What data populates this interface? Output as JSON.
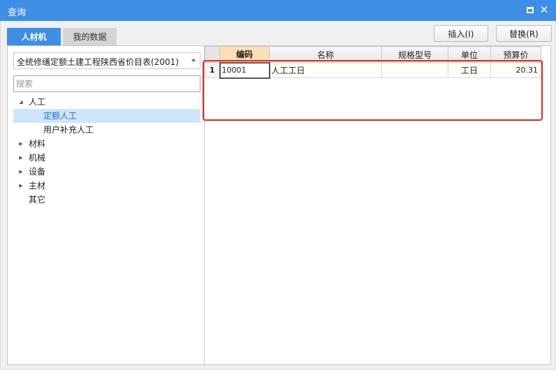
{
  "window": {
    "title": "查询",
    "maximize_icon": "maximize-icon",
    "close_icon": "close-icon"
  },
  "tabs": [
    {
      "label": "人材机",
      "active": true
    },
    {
      "label": "我的数据",
      "active": false
    }
  ],
  "toolbar": {
    "insert_label": "插入(I)",
    "replace_label": "替换(R)"
  },
  "left": {
    "combo_value": "全统修缮定额土建工程陕西省价目表(2001)",
    "search_placeholder": "搜索",
    "tree": [
      {
        "label": "人工",
        "level": 0,
        "expanded": true
      },
      {
        "label": "定额人工",
        "level": 1,
        "selected": true
      },
      {
        "label": "用户补充人工",
        "level": 1
      },
      {
        "label": "材料",
        "level": 0,
        "expanded": false
      },
      {
        "label": "机械",
        "level": 0,
        "expanded": false
      },
      {
        "label": "设备",
        "level": 0,
        "expanded": false
      },
      {
        "label": "主材",
        "level": 0,
        "expanded": false
      },
      {
        "label": "其它",
        "level": 0,
        "leaf": true
      }
    ]
  },
  "grid": {
    "headers": {
      "code": "编码",
      "name": "名称",
      "spec": "规格型号",
      "unit": "单位",
      "price": "预算价"
    },
    "rows": [
      {
        "num": "1",
        "code": "10001",
        "name": "人工工日",
        "spec": "",
        "unit": "工日",
        "price": "20.31"
      }
    ]
  },
  "colors": {
    "titlebar": "#3d8fe6",
    "active_tab": "#3d8fe6",
    "selected_row": "#cfe5f9",
    "highlight_border": "#e8231f",
    "code_header": "#fde0b8"
  }
}
